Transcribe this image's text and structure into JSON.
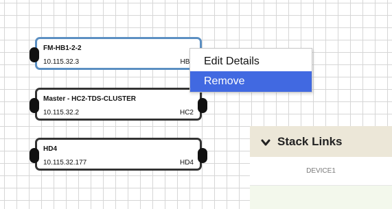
{
  "nodes": [
    {
      "name": "FM-HB1-2-2",
      "ip": "10.115.32.3",
      "tag": "HB1",
      "selected": true
    },
    {
      "name": "Master - HC2-TDS-CLUSTER",
      "ip": "10.115.32.2",
      "tag": "HC2",
      "selected": false
    },
    {
      "name": "HD4",
      "ip": "10.115.32.177",
      "tag": "HD4",
      "selected": false
    }
  ],
  "context_menu": {
    "items": [
      {
        "label": "Edit Details",
        "highlighted": false
      },
      {
        "label": "Remove",
        "highlighted": true
      }
    ],
    "highlight_color": "#4169e1"
  },
  "stack_links": {
    "title": "Stack Links",
    "expanded_icon": "chevron-down-icon",
    "columns": [
      "DEVICE1"
    ]
  },
  "colors": {
    "selected_border": "#5b8fc2",
    "node_border": "#333333",
    "panel_header_bg": "#ece7d8"
  }
}
